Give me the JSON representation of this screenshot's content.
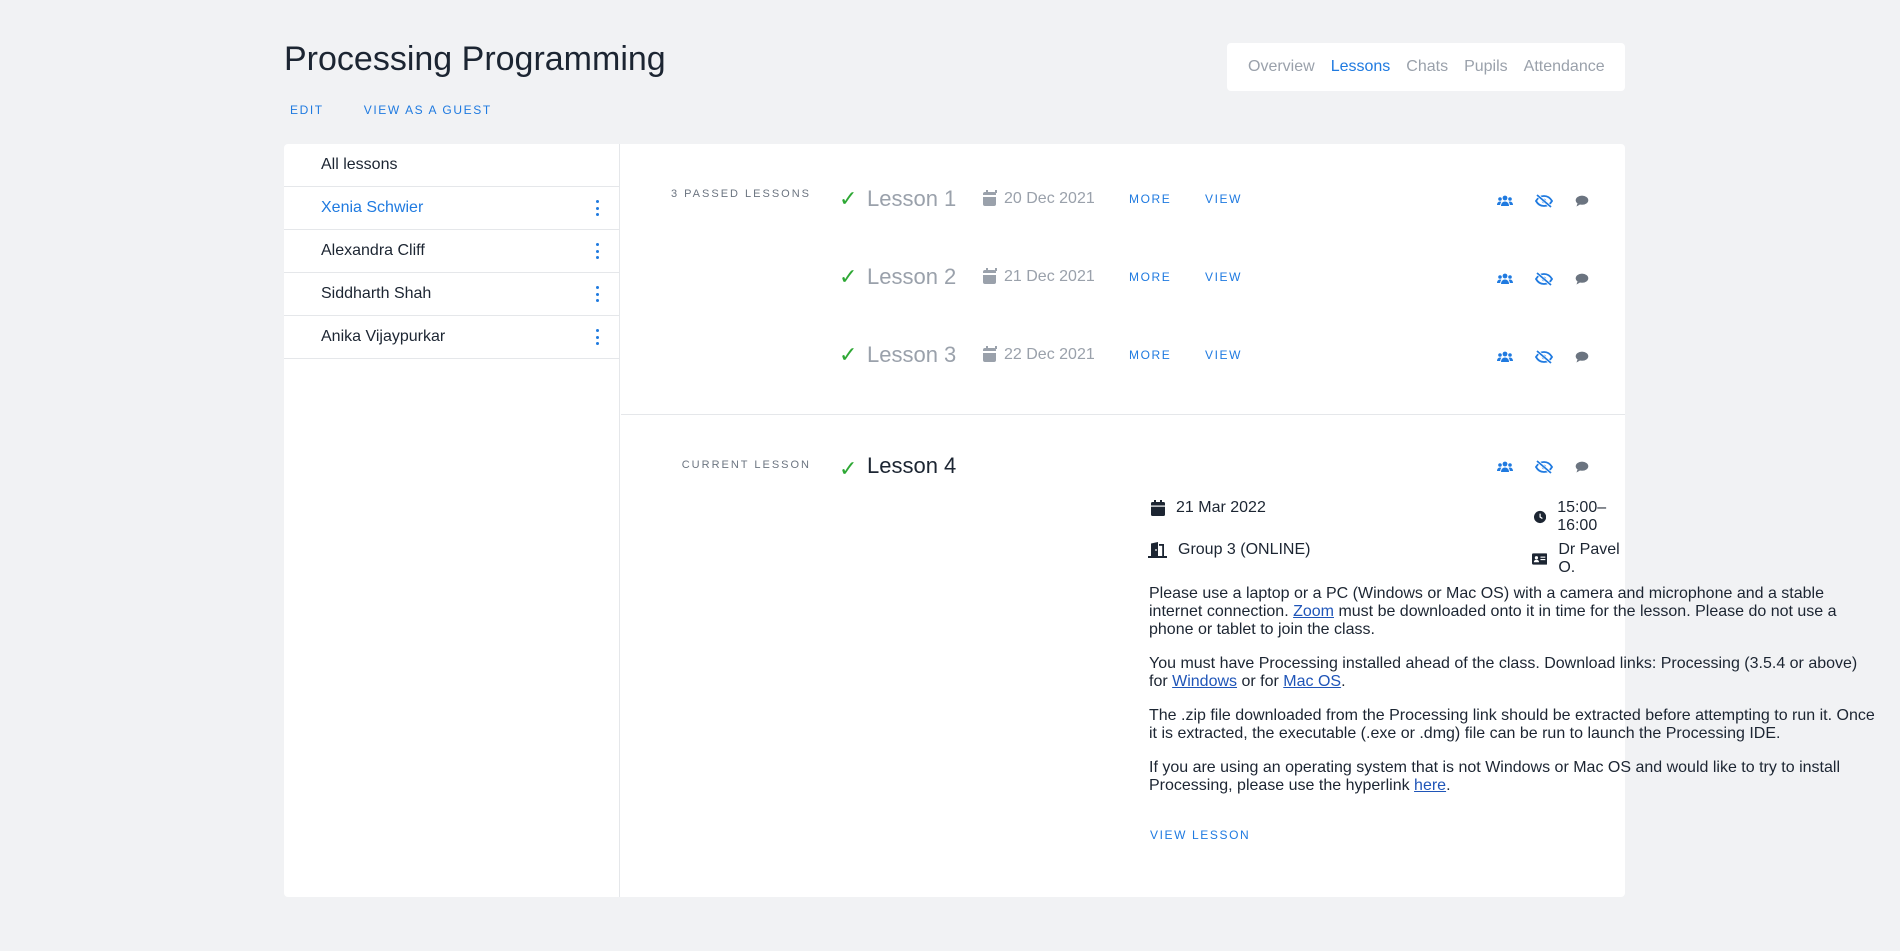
{
  "header": {
    "title": "Processing Programming",
    "edit_label": "EDIT",
    "guest_label": "VIEW AS A GUEST"
  },
  "tabs": [
    {
      "label": "Overview",
      "active": false
    },
    {
      "label": "Lessons",
      "active": true
    },
    {
      "label": "Chats",
      "active": false
    },
    {
      "label": "Pupils",
      "active": false
    },
    {
      "label": "Attendance",
      "active": false
    }
  ],
  "sidebar": {
    "items": [
      {
        "label": "All lessons",
        "active": false
      },
      {
        "label": "Xenia Schwier",
        "active": true
      },
      {
        "label": "Alexandra Cliff",
        "active": false
      },
      {
        "label": "Siddharth Shah",
        "active": false
      },
      {
        "label": "Anika Vijaypurkar",
        "active": false
      }
    ]
  },
  "passed": {
    "label": "3 PASSED LESSONS",
    "lessons": [
      {
        "name": "Lesson 1",
        "date": "20 Dec 2021",
        "more": "MORE",
        "view": "VIEW"
      },
      {
        "name": "Lesson 2",
        "date": "21 Dec 2021",
        "more": "MORE",
        "view": "VIEW"
      },
      {
        "name": "Lesson 3",
        "date": "22 Dec 2021",
        "more": "MORE",
        "view": "VIEW"
      }
    ]
  },
  "current": {
    "label": "CURRENT LESSON",
    "name": "Lesson 4",
    "date": "21 Mar 2022",
    "time": "15:00–16:00",
    "group": "Group 3 (ONLINE)",
    "teacher": "Dr Pavel O.",
    "p1_a": "Please use a laptop or a PC (Windows or Mac OS) with a camera and microphone and a stable internet connection. ",
    "p1_link": "Zoom",
    "p1_b": " must be downloaded onto it in time for the lesson. Please do not use a phone or tablet to join the class.",
    "p2_a": "You must have Processing installed ahead of the class. Download links: Processing (3.5.4 or above) for ",
    "p2_link1": "Windows",
    "p2_mid": " or for ",
    "p2_link2": "Mac OS",
    "p2_end": ".",
    "p3": "The .zip file downloaded from the Processing link should be extracted before attempting to run it. Once it is extracted, the executable (.exe or .dmg) file can be run to launch the Processing IDE.",
    "p4_a": "If you are using an operating system that is not Windows or Mac OS and would like to try to install Processing, please use the hyperlink ",
    "p4_link": "here",
    "p4_end": ".",
    "view_lesson": "VIEW LESSON"
  },
  "colors": {
    "accent": "#1f7ae0",
    "check": "#2ea835",
    "muted": "#9aa1ab",
    "background": "#f1f2f4"
  },
  "icons": [
    "users-icon",
    "eye-slash-icon",
    "comment-icon",
    "calendar-icon",
    "clock-icon",
    "door-icon",
    "id-card-icon",
    "check-icon",
    "more-vertical-icon"
  ]
}
